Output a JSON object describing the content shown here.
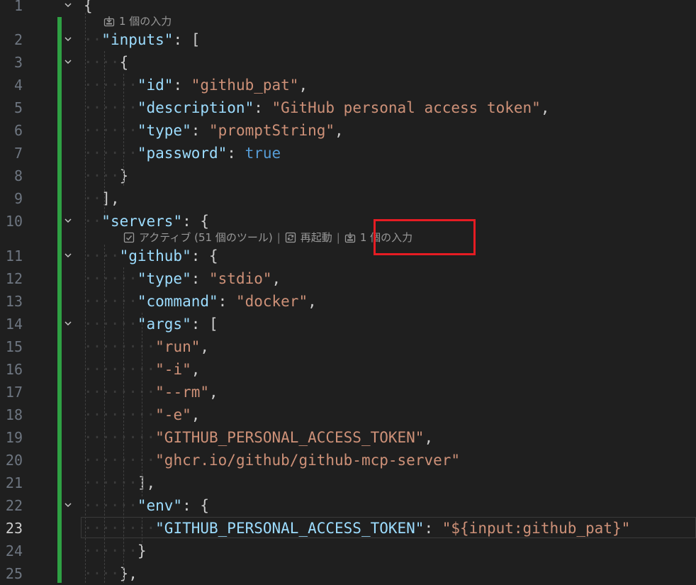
{
  "colors": {
    "background": "#1f1f1f",
    "line_number": "#6e7681",
    "line_number_current": "#cccccc",
    "json_key": "#9cdcfe",
    "json_string": "#ce9178",
    "json_boolean": "#569cd6",
    "punctuation": "#cccccc",
    "git_modified_bar": "#2ea043",
    "annotation_box": "#e51c23"
  },
  "editor": {
    "current_line": 23,
    "codelens": {
      "inputs_count": "1 個の入力",
      "server_status": "アクティブ (51 個のツール)",
      "separator": "|",
      "restart": "再起動",
      "server_inputs_count": "1 個の入力"
    },
    "lines": [
      {
        "num": "1",
        "tokens": [
          {
            "t": "p",
            "v": "{"
          }
        ]
      },
      {
        "num": "2",
        "tokens": [
          {
            "t": "key",
            "v": "\"inputs\""
          },
          {
            "t": "p",
            "v": ": ["
          }
        ]
      },
      {
        "num": "3",
        "tokens": [
          {
            "t": "p",
            "v": "{"
          }
        ]
      },
      {
        "num": "4",
        "tokens": [
          {
            "t": "key",
            "v": "\"id\""
          },
          {
            "t": "p",
            "v": ": "
          },
          {
            "t": "str",
            "v": "\"github_pat\""
          },
          {
            "t": "p",
            "v": ","
          }
        ]
      },
      {
        "num": "5",
        "tokens": [
          {
            "t": "key",
            "v": "\"description\""
          },
          {
            "t": "p",
            "v": ": "
          },
          {
            "t": "str",
            "v": "\"GitHub personal access token\""
          },
          {
            "t": "p",
            "v": ","
          }
        ]
      },
      {
        "num": "6",
        "tokens": [
          {
            "t": "key",
            "v": "\"type\""
          },
          {
            "t": "p",
            "v": ": "
          },
          {
            "t": "str",
            "v": "\"promptString\""
          },
          {
            "t": "p",
            "v": ","
          }
        ]
      },
      {
        "num": "7",
        "tokens": [
          {
            "t": "key",
            "v": "\"password\""
          },
          {
            "t": "p",
            "v": ": "
          },
          {
            "t": "kw",
            "v": "true"
          }
        ]
      },
      {
        "num": "8",
        "tokens": [
          {
            "t": "p",
            "v": "}"
          }
        ]
      },
      {
        "num": "9",
        "tokens": [
          {
            "t": "p",
            "v": "],"
          }
        ]
      },
      {
        "num": "10",
        "tokens": [
          {
            "t": "key",
            "v": "\"servers\""
          },
          {
            "t": "p",
            "v": ": {"
          }
        ]
      },
      {
        "num": "11",
        "tokens": [
          {
            "t": "key",
            "v": "\"github\""
          },
          {
            "t": "p",
            "v": ": {"
          }
        ]
      },
      {
        "num": "12",
        "tokens": [
          {
            "t": "key",
            "v": "\"type\""
          },
          {
            "t": "p",
            "v": ": "
          },
          {
            "t": "str",
            "v": "\"stdio\""
          },
          {
            "t": "p",
            "v": ","
          }
        ]
      },
      {
        "num": "13",
        "tokens": [
          {
            "t": "key",
            "v": "\"command\""
          },
          {
            "t": "p",
            "v": ": "
          },
          {
            "t": "str",
            "v": "\"docker\""
          },
          {
            "t": "p",
            "v": ","
          }
        ]
      },
      {
        "num": "14",
        "tokens": [
          {
            "t": "key",
            "v": "\"args\""
          },
          {
            "t": "p",
            "v": ": ["
          }
        ]
      },
      {
        "num": "15",
        "tokens": [
          {
            "t": "str",
            "v": "\"run\""
          },
          {
            "t": "p",
            "v": ","
          }
        ]
      },
      {
        "num": "16",
        "tokens": [
          {
            "t": "str",
            "v": "\"-i\""
          },
          {
            "t": "p",
            "v": ","
          }
        ]
      },
      {
        "num": "17",
        "tokens": [
          {
            "t": "str",
            "v": "\"--rm\""
          },
          {
            "t": "p",
            "v": ","
          }
        ]
      },
      {
        "num": "18",
        "tokens": [
          {
            "t": "str",
            "v": "\"-e\""
          },
          {
            "t": "p",
            "v": ","
          }
        ]
      },
      {
        "num": "19",
        "tokens": [
          {
            "t": "str",
            "v": "\"GITHUB_PERSONAL_ACCESS_TOKEN\""
          },
          {
            "t": "p",
            "v": ","
          }
        ]
      },
      {
        "num": "20",
        "tokens": [
          {
            "t": "str",
            "v": "\"ghcr.io/github/github-mcp-server\""
          }
        ]
      },
      {
        "num": "21",
        "tokens": [
          {
            "t": "p",
            "v": "],"
          }
        ]
      },
      {
        "num": "22",
        "tokens": [
          {
            "t": "key",
            "v": "\"env\""
          },
          {
            "t": "p",
            "v": ": {"
          }
        ]
      },
      {
        "num": "23",
        "tokens": [
          {
            "t": "key",
            "v": "\"GITHUB_PERSONAL_ACCESS_TOKEN\""
          },
          {
            "t": "p",
            "v": ": "
          },
          {
            "t": "str",
            "v": "\"${input:github_pat}\""
          }
        ]
      },
      {
        "num": "24",
        "tokens": [
          {
            "t": "p",
            "v": "}"
          }
        ]
      },
      {
        "num": "25",
        "tokens": [
          {
            "t": "p",
            "v": "},"
          }
        ]
      }
    ]
  }
}
